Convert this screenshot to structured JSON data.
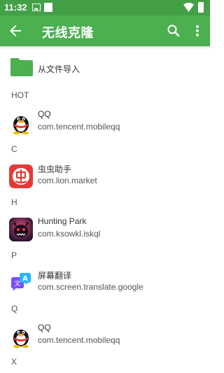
{
  "status_bar": {
    "time": "11:32"
  },
  "app_bar": {
    "title": "无线克隆"
  },
  "import_row": {
    "label": "从文件导入"
  },
  "sections": [
    {
      "header": "HOT",
      "apps": [
        {
          "name": "QQ",
          "package": "com.tencent.mobileqq",
          "icon": "qq-penguin-icon"
        }
      ]
    },
    {
      "header": "C",
      "apps": [
        {
          "name": "虫虫助手",
          "package": "com.lion.market",
          "icon": "chongchong-icon"
        }
      ]
    },
    {
      "header": "H",
      "apps": [
        {
          "name": "Hunting Park",
          "package": "com.ksowkl.iskql",
          "icon": "hunting-park-icon"
        }
      ]
    },
    {
      "header": "P",
      "apps": [
        {
          "name": "屏幕翻译",
          "package": "com.screen.translate.google",
          "icon": "screen-translate-icon"
        }
      ]
    },
    {
      "header": "Q",
      "apps": [
        {
          "name": "QQ",
          "package": "com.tencent.mobileqq",
          "icon": "qq-penguin-icon"
        }
      ]
    },
    {
      "header": "X",
      "apps": []
    }
  ],
  "colors": {
    "status_bar": "#43a047",
    "app_bar": "#4caf50",
    "folder": "#4caf50"
  }
}
